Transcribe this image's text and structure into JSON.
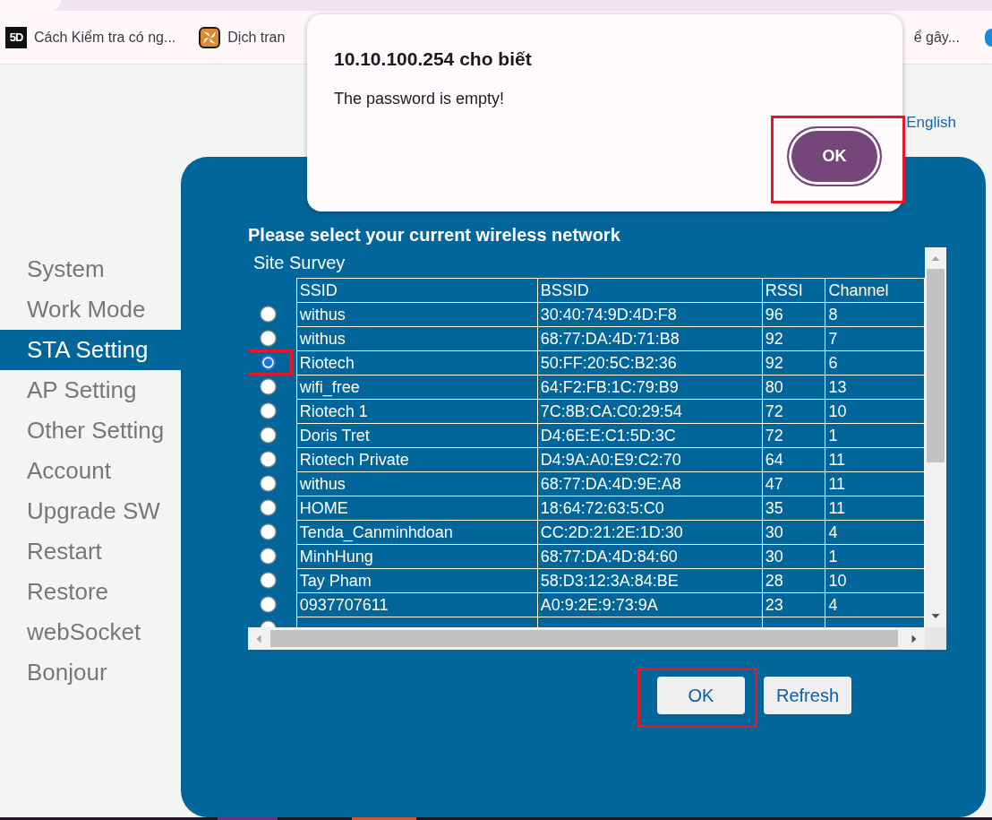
{
  "browser": {
    "bookmarks": [
      {
        "kind": "badge",
        "badge": "5D",
        "label": "Cách Kiểm tra có ng..."
      },
      {
        "kind": "pinwheel",
        "label": "Dịch tran"
      },
      {
        "kind": "text",
        "label": "ể gây..."
      },
      {
        "kind": "dot"
      }
    ]
  },
  "page": {
    "language_link": "English",
    "menu": [
      {
        "label": "System",
        "selected": false
      },
      {
        "label": "Work Mode",
        "selected": false
      },
      {
        "label": "STA Setting",
        "selected": true
      },
      {
        "label": "AP Setting",
        "selected": false
      },
      {
        "label": "Other Setting",
        "selected": false
      },
      {
        "label": "Account",
        "selected": false
      },
      {
        "label": "Upgrade SW",
        "selected": false
      },
      {
        "label": "Restart",
        "selected": false
      },
      {
        "label": "Restore",
        "selected": false
      },
      {
        "label": "webSocket",
        "selected": false
      },
      {
        "label": "Bonjour",
        "selected": false
      }
    ],
    "panel": {
      "heading": "Please select your current wireless network",
      "survey_title": "Site Survey",
      "columns": [
        "SSID",
        "BSSID",
        "RSSI",
        "Channel"
      ],
      "rows": [
        {
          "ssid": "withus",
          "bssid": "30:40:74:9D:4D:F8",
          "rssi": "96",
          "channel": "8",
          "selected": false,
          "highlighted": false
        },
        {
          "ssid": "withus",
          "bssid": "68:77:DA:4D:71:B8",
          "rssi": "92",
          "channel": "7",
          "selected": false,
          "highlighted": false
        },
        {
          "ssid": "Riotech",
          "bssid": "50:FF:20:5C:B2:36",
          "rssi": "92",
          "channel": "6",
          "selected": true,
          "highlighted": true
        },
        {
          "ssid": "wifi_free",
          "bssid": "64:F2:FB:1C:79:B9",
          "rssi": "80",
          "channel": "13",
          "selected": false,
          "highlighted": false
        },
        {
          "ssid": "Riotech 1",
          "bssid": "7C:8B:CA:C0:29:54",
          "rssi": "72",
          "channel": "10",
          "selected": false,
          "highlighted": false
        },
        {
          "ssid": "Doris Tret",
          "bssid": "D4:6E:E:C1:5D:3C",
          "rssi": "72",
          "channel": "1",
          "selected": false,
          "highlighted": false
        },
        {
          "ssid": "Riotech Private",
          "bssid": "D4:9A:A0:E9:C2:70",
          "rssi": "64",
          "channel": "11",
          "selected": false,
          "highlighted": false
        },
        {
          "ssid": "withus",
          "bssid": "68:77:DA:4D:9E:A8",
          "rssi": "47",
          "channel": "11",
          "selected": false,
          "highlighted": false
        },
        {
          "ssid": "HOME",
          "bssid": "18:64:72:63:5:C0",
          "rssi": "35",
          "channel": "11",
          "selected": false,
          "highlighted": false
        },
        {
          "ssid": "Tenda_Canminhdoan",
          "bssid": "CC:2D:21:2E:1D:30",
          "rssi": "30",
          "channel": "4",
          "selected": false,
          "highlighted": false
        },
        {
          "ssid": "MinhHung",
          "bssid": "68:77:DA:4D:84:60",
          "rssi": "30",
          "channel": "1",
          "selected": false,
          "highlighted": false
        },
        {
          "ssid": "Tay Pham",
          "bssid": "58:D3:12:3A:84:BE",
          "rssi": "28",
          "channel": "10",
          "selected": false,
          "highlighted": false
        },
        {
          "ssid": "0937707611",
          "bssid": "A0:9:2E:9:73:9A",
          "rssi": "23",
          "channel": "4",
          "selected": false,
          "highlighted": false
        },
        {
          "selected": false,
          "highlighted": false
        }
      ],
      "buttons": [
        {
          "label": "OK",
          "highlighted": true
        },
        {
          "label": "Refresh",
          "highlighted": false
        }
      ]
    }
  },
  "dialog": {
    "title": "10.10.100.254 cho biết",
    "message": "The password is empty!",
    "ok_button": {
      "label": "OK",
      "highlighted": true
    }
  }
}
